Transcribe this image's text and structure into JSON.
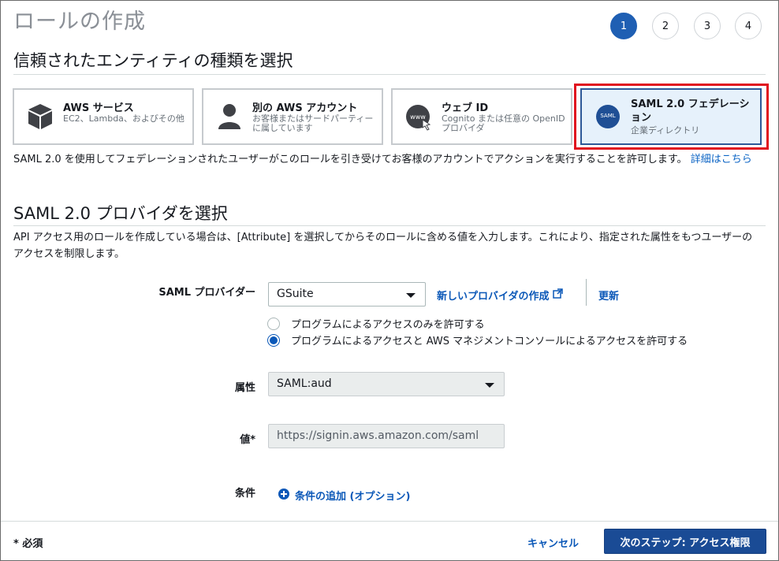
{
  "header": {
    "title": "ロールの作成",
    "steps": [
      "1",
      "2",
      "3",
      "4"
    ],
    "active_step": 1
  },
  "trust_section": {
    "title": "信頼されたエンティティの種類を選択",
    "cards": [
      {
        "title": "AWS サービス",
        "desc": "EC2、Lambda、およびその他",
        "icon": "box-icon"
      },
      {
        "title": "別の AWS アカウント",
        "desc": "お客様またはサードパーティーに属しています",
        "icon": "person-icon"
      },
      {
        "title": "ウェブ ID",
        "desc": "Cognito または任意の OpenID プロバイダ",
        "icon": "www-globe-icon"
      },
      {
        "title": "SAML 2.0 フェデレーション",
        "desc": "企業ディレクトリ",
        "icon": "saml-icon",
        "icon_text": "SAML",
        "selected": true
      }
    ],
    "description": "SAML 2.0 を使用してフェデレーションされたユーザーがこのロールを引き受けてお客様のアカウントでアクションを実行することを許可します。",
    "details_link": "詳細はこちら"
  },
  "provider_section": {
    "title": "SAML 2.0 プロバイダを選択",
    "description": "API アクセス用のロールを作成している場合は、[Attribute] を選択してからそのロールに含める値を入力します。これにより、指定された属性をもつユーザーのアクセスを制限します。"
  },
  "form": {
    "provider_label": "SAML プロバイダー",
    "provider_value": "GSuite",
    "create_provider_link": "新しいプロバイダの作成",
    "refresh_link": "更新",
    "radio_options": [
      {
        "label": "プログラムによるアクセスのみを許可する",
        "checked": false
      },
      {
        "label": "プログラムによるアクセスと AWS マネジメントコンソールによるアクセスを許可する",
        "checked": true
      }
    ],
    "attribute_label": "属性",
    "attribute_value": "SAML:aud",
    "value_label": "値*",
    "value_value": "https://signin.aws.amazon.com/saml",
    "condition_label": "条件",
    "add_condition_link": "条件の追加 (オプション)"
  },
  "footer": {
    "required_note": "* 必須",
    "cancel_label": "キャンセル",
    "next_label": "次のステップ: アクセス権限"
  },
  "colors": {
    "primary": "#1a4b95",
    "link": "#0b58b8",
    "selected_card_bg": "#e6f1fb",
    "highlight": "#e0101f"
  }
}
